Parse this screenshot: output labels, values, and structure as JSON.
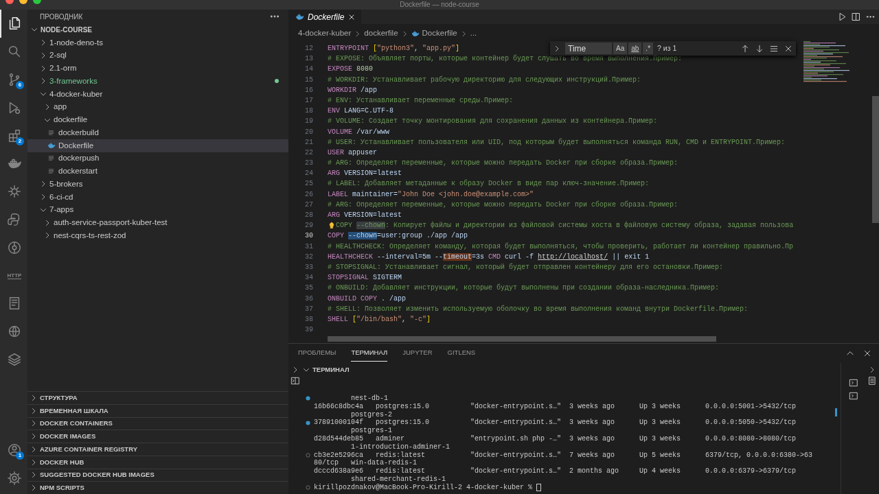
{
  "window": {
    "title": "Dockerfile — node-course"
  },
  "activity_bar": {
    "top": [
      {
        "kind": "explorer",
        "selected": true
      },
      {
        "kind": "search",
        "selected": false
      },
      {
        "kind": "source-control",
        "selected": false,
        "badge": "6"
      },
      {
        "kind": "run-debug",
        "selected": false
      },
      {
        "kind": "extensions",
        "selected": false,
        "badge": "2"
      },
      {
        "kind": "docker",
        "selected": false
      },
      {
        "kind": "wheel",
        "selected": false
      },
      {
        "kind": "python",
        "selected": false
      },
      {
        "kind": "gitlens",
        "selected": false
      },
      {
        "kind": "http",
        "selected": false,
        "label": "HTTP"
      },
      {
        "kind": "notebook",
        "selected": false
      },
      {
        "kind": "globe",
        "selected": false
      },
      {
        "kind": "layers",
        "selected": false
      }
    ],
    "bottom": [
      {
        "kind": "account",
        "badge": "1"
      },
      {
        "kind": "settings"
      }
    ]
  },
  "sidebar": {
    "title": "ПРОВОДНИК",
    "tree": [
      {
        "label": "NODE-COURSE",
        "kind": "root",
        "expanded": true,
        "selected": false,
        "decorated": false,
        "children": [
          {
            "label": "1-node-deno-ts",
            "kind": "folder",
            "expanded": false,
            "selected": false,
            "decorated": false
          },
          {
            "label": "2-sql",
            "kind": "folder",
            "expanded": false,
            "selected": false,
            "decorated": false
          },
          {
            "label": "2.1-orm",
            "kind": "folder",
            "expanded": false,
            "selected": false,
            "decorated": false
          },
          {
            "label": "3-frameworks",
            "kind": "folder",
            "expanded": false,
            "selected": false,
            "decorated": true
          },
          {
            "label": "4-docker-kuber",
            "kind": "folder",
            "expanded": true,
            "selected": false,
            "decorated": false,
            "children": [
              {
                "label": "app",
                "kind": "folder",
                "expanded": false,
                "selected": false,
                "decorated": false
              },
              {
                "label": "dockerfile",
                "kind": "folder",
                "expanded": true,
                "selected": false,
                "decorated": false,
                "children": [
                  {
                    "label": "dockerbuild",
                    "kind": "file",
                    "selected": false,
                    "decorated": false
                  },
                  {
                    "label": "Dockerfile",
                    "kind": "dockerfile",
                    "selected": true,
                    "decorated": false
                  },
                  {
                    "label": "dockerpush",
                    "kind": "file",
                    "selected": false,
                    "decorated": false
                  },
                  {
                    "label": "dockerstart",
                    "kind": "file",
                    "selected": false,
                    "decorated": false
                  }
                ]
              }
            ]
          },
          {
            "label": "5-brokers",
            "kind": "folder",
            "expanded": false,
            "selected": false,
            "decorated": false
          },
          {
            "label": "6-ci-cd",
            "kind": "folder",
            "expanded": false,
            "selected": false,
            "decorated": false
          },
          {
            "label": "7-apps",
            "kind": "folder",
            "expanded": true,
            "selected": false,
            "decorated": false,
            "children": [
              {
                "label": "auth-service-passport-kuber-test",
                "kind": "folder",
                "expanded": false,
                "selected": false,
                "decorated": false
              },
              {
                "label": "nest-cqrs-ts-rest-zod",
                "kind": "folder",
                "expanded": false,
                "selected": false,
                "decorated": false
              }
            ]
          }
        ]
      }
    ],
    "sections": [
      {
        "label": "СТРУКТУРА",
        "expanded": false
      },
      {
        "label": "ВРЕМЕННАЯ ШКАЛА",
        "expanded": false
      },
      {
        "label": "DOCKER CONTAINERS",
        "expanded": false
      },
      {
        "label": "DOCKER IMAGES",
        "expanded": false
      },
      {
        "label": "AZURE CONTAINER REGISTRY",
        "expanded": false
      },
      {
        "label": "DOCKER HUB",
        "expanded": false
      },
      {
        "label": "SUGGESTED DOCKER HUB IMAGES",
        "expanded": false
      },
      {
        "label": "NPM SCRIPTS",
        "expanded": false
      }
    ]
  },
  "editor": {
    "tabs": [
      {
        "label": "Dockerfile",
        "selected": true,
        "preview": true
      }
    ],
    "breadcrumbs": [
      {
        "label": "4-docker-kuber",
        "kind": "folder"
      },
      {
        "label": "dockerfile",
        "kind": "folder"
      },
      {
        "label": "Dockerfile",
        "kind": "dockerfile"
      },
      {
        "label": "...",
        "kind": "more"
      }
    ],
    "find": {
      "value": "Time",
      "toggles": [
        {
          "label": "Aa",
          "on": false
        },
        {
          "label": "ab",
          "on": false
        },
        {
          "label": ".*",
          "on": false
        }
      ],
      "result": "? из 1"
    },
    "lines": [
      {
        "number": "12",
        "current": false,
        "tokens": [
          {
            "kind": "keyword",
            "text": "ENTRYPOINT "
          },
          {
            "kind": "bracket",
            "text": "["
          },
          {
            "kind": "string",
            "text": "\"python3\""
          },
          {
            "kind": "text",
            "text": ", "
          },
          {
            "kind": "string",
            "text": "\"app.py\""
          },
          {
            "kind": "bracket",
            "text": "]"
          }
        ]
      },
      {
        "number": "13",
        "current": false,
        "tokens": [
          {
            "kind": "comment",
            "text": "# EXPOSE: Объявляет порты, которые контейнер будет слушать во время выполнения.Пример:"
          }
        ]
      },
      {
        "number": "14",
        "current": false,
        "tokens": [
          {
            "kind": "keyword",
            "text": "EXPOSE "
          },
          {
            "kind": "number",
            "text": "8080"
          }
        ]
      },
      {
        "number": "15",
        "current": false,
        "tokens": [
          {
            "kind": "comment",
            "text": "# WORKDIR: Устанавливает рабочую директорию для следующих инструкций.Пример:"
          }
        ]
      },
      {
        "number": "16",
        "current": false,
        "tokens": [
          {
            "kind": "keyword",
            "text": "WORKDIR"
          },
          {
            "kind": "text",
            "text": " /app"
          }
        ]
      },
      {
        "number": "17",
        "current": false,
        "tokens": [
          {
            "kind": "comment",
            "text": "# ENV: Устанавливает переменные среды.Пример:"
          }
        ]
      },
      {
        "number": "18",
        "current": false,
        "tokens": [
          {
            "kind": "keyword",
            "text": "ENV"
          },
          {
            "kind": "text",
            "text": " LANG=C.UTF-8"
          }
        ]
      },
      {
        "number": "19",
        "current": false,
        "tokens": [
          {
            "kind": "comment",
            "text": "# VOLUME: Создает точку монтирования для сохранения данных из контейнера.Пример:"
          }
        ]
      },
      {
        "number": "20",
        "current": false,
        "tokens": [
          {
            "kind": "keyword",
            "text": "VOLUME"
          },
          {
            "kind": "text",
            "text": " /var/www"
          }
        ]
      },
      {
        "number": "21",
        "current": false,
        "tokens": [
          {
            "kind": "comment",
            "text": "# USER: Устанавливает пользователя или UID, под которым будет выполняться команда RUN, CMD и ENTRYPOINT.Пример:"
          }
        ]
      },
      {
        "number": "22",
        "current": false,
        "tokens": [
          {
            "kind": "keyword",
            "text": "USER"
          },
          {
            "kind": "text",
            "text": " appuser"
          }
        ]
      },
      {
        "number": "23",
        "current": false,
        "tokens": [
          {
            "kind": "comment",
            "text": "# ARG: Определяет переменные, которые можно передать Docker при сборке образа.Пример:"
          }
        ]
      },
      {
        "number": "24",
        "current": false,
        "tokens": [
          {
            "kind": "keyword",
            "text": "ARG"
          },
          {
            "kind": "text",
            "text": " VERSION=latest"
          }
        ]
      },
      {
        "number": "25",
        "current": false,
        "tokens": [
          {
            "kind": "comment",
            "text": "# LABEL: Добавляет метаданные к образу Docker в виде пар ключ-значение.Пример:"
          }
        ]
      },
      {
        "number": "26",
        "current": false,
        "tokens": [
          {
            "kind": "keyword",
            "text": "LABEL"
          },
          {
            "kind": "text",
            "text": " maintainer="
          },
          {
            "kind": "string",
            "text": "\"John Doe <john.doe@example.com>\""
          }
        ]
      },
      {
        "number": "27",
        "current": false,
        "tokens": [
          {
            "kind": "comment",
            "text": "# ARG: Определяет переменные, которые можно передать Docker при сборке образа.Пример:"
          }
        ]
      },
      {
        "number": "28",
        "current": false,
        "tokens": [
          {
            "kind": "keyword",
            "text": "ARG"
          },
          {
            "kind": "text",
            "text": " VERSION=latest"
          }
        ]
      },
      {
        "number": "29",
        "current": false,
        "lightbulb": true,
        "tokens": [
          {
            "kind": "comment",
            "text": "COPY "
          },
          {
            "kind": "comment-occurrence",
            "text": "--chown"
          },
          {
            "kind": "comment",
            "text": ": Копирует файлы и директории из файловой системы хоста в файловую систему образа, задавая пользова"
          }
        ]
      },
      {
        "number": "30",
        "current": true,
        "tokens": [
          {
            "kind": "keyword",
            "text": "COPY "
          },
          {
            "kind": "text-selection",
            "text": "--chown"
          },
          {
            "kind": "text",
            "text": "=user:group ./app /app"
          }
        ]
      },
      {
        "number": "31",
        "current": false,
        "tokens": [
          {
            "kind": "comment",
            "text": "# HEALTHCHECK: Определяет команду, которая будет выполняться, чтобы проверить, работает ли контейнер правильно.Пр"
          }
        ]
      },
      {
        "number": "32",
        "current": false,
        "tokens": [
          {
            "kind": "keyword",
            "text": "HEALTHCHECK"
          },
          {
            "kind": "text",
            "text": " --interval=5m --"
          },
          {
            "kind": "text-match",
            "text": "timeout"
          },
          {
            "kind": "text",
            "text": "=3s "
          },
          {
            "kind": "keyword",
            "text": "CMD"
          },
          {
            "kind": "text",
            "text": " curl -f "
          },
          {
            "kind": "link",
            "text": "http://localhost/"
          },
          {
            "kind": "text",
            "text": " || exit 1"
          }
        ]
      },
      {
        "number": "33",
        "current": false,
        "tokens": [
          {
            "kind": "comment",
            "text": "# STOPSIGNAL: Устанавливает сигнал, который будет отправлен контейнеру для его остановки.Пример:"
          }
        ]
      },
      {
        "number": "34",
        "current": false,
        "tokens": [
          {
            "kind": "keyword",
            "text": "STOPSIGNAL"
          },
          {
            "kind": "text",
            "text": " SIGTERM"
          }
        ]
      },
      {
        "number": "35",
        "current": false,
        "tokens": [
          {
            "kind": "comment",
            "text": "# ONBUILD: Добавляет инструкции, которые будут выполнены при создании образа-наследника.Пример:"
          }
        ]
      },
      {
        "number": "36",
        "current": false,
        "tokens": [
          {
            "kind": "keyword",
            "text": "ONBUILD COPY"
          },
          {
            "kind": "text",
            "text": " . /app"
          }
        ]
      },
      {
        "number": "37",
        "current": false,
        "tokens": [
          {
            "kind": "comment",
            "text": "# SHELL: Позволяет изменить используемую оболочку во время выполнения команд внутри Dockerfile.Пример:"
          }
        ]
      },
      {
        "number": "38",
        "current": false,
        "tokens": [
          {
            "kind": "keyword",
            "text": "SHELL "
          },
          {
            "kind": "bracket",
            "text": "["
          },
          {
            "kind": "string",
            "text": "\"/bin/bash\""
          },
          {
            "kind": "text",
            "text": ", "
          },
          {
            "kind": "string",
            "text": "\"-c\""
          },
          {
            "kind": "bracket",
            "text": "]"
          }
        ]
      },
      {
        "number": "39",
        "current": false
      }
    ]
  },
  "panel": {
    "tabs": [
      {
        "label": "ПРОБЛЕМЫ",
        "selected": false
      },
      {
        "label": "ТЕРМИНАЛ",
        "selected": true
      },
      {
        "label": "JUPYTER",
        "selected": false
      },
      {
        "label": "GITLENS",
        "selected": false
      }
    ],
    "section": "ТЕРМИНАЛ",
    "terminal_lines": [
      {
        "text": "         nest-db-1",
        "decorated": true,
        "succeeded": true,
        "kind": "output"
      },
      {
        "text": "16b66c8dbc4a   postgres:15.0          \"docker-entrypoint.s…\"  3 weeks ago      Up 3 weeks      0.0.0.0:5001->5432/tcp",
        "decorated": false,
        "kind": "output"
      },
      {
        "text": "         postgres-2",
        "decorated": false,
        "kind": "output"
      },
      {
        "text": "37891000104f   postgres:15.0          \"docker-entrypoint.s…\"  3 weeks ago      Up 3 weeks      0.0.0.0:5050->5432/tcp",
        "decorated": true,
        "succeeded": true,
        "kind": "output"
      },
      {
        "text": "         postgres-1",
        "decorated": false,
        "kind": "output"
      },
      {
        "text": "d28d544deb85   adminer                \"entrypoint.sh php -…\"  3 weeks ago      Up 3 weeks      0.0.0.0:8080->8080/tcp",
        "decorated": false,
        "kind": "output"
      },
      {
        "text": "         1-introduction-adminer-1",
        "decorated": false,
        "kind": "output"
      },
      {
        "text": "cb3e2e5296ca   redis:latest           \"docker-entrypoint.s…\"  7 weeks ago      Up 5 weeks      6379/tcp, 0.0.0.0:6380->63",
        "decorated": true,
        "succeeded": false,
        "kind": "output"
      },
      {
        "text": "80/tcp   win-data-redis-1",
        "decorated": false,
        "kind": "output"
      },
      {
        "text": "dcccd638a9e6   redis:latest           \"docker-entrypoint.s…\"  2 months ago     Up 4 weeks      0.0.0.0:6379->6379/tcp",
        "decorated": false,
        "kind": "output"
      },
      {
        "text": "         shared-merchant-redis-1",
        "decorated": false,
        "kind": "output"
      },
      {
        "text": "kirillpozdnakov@MacBook-Pro-Kirill-2 4-docker-kuber %",
        "decorated": true,
        "succeeded": false,
        "kind": "prompt"
      }
    ]
  }
}
